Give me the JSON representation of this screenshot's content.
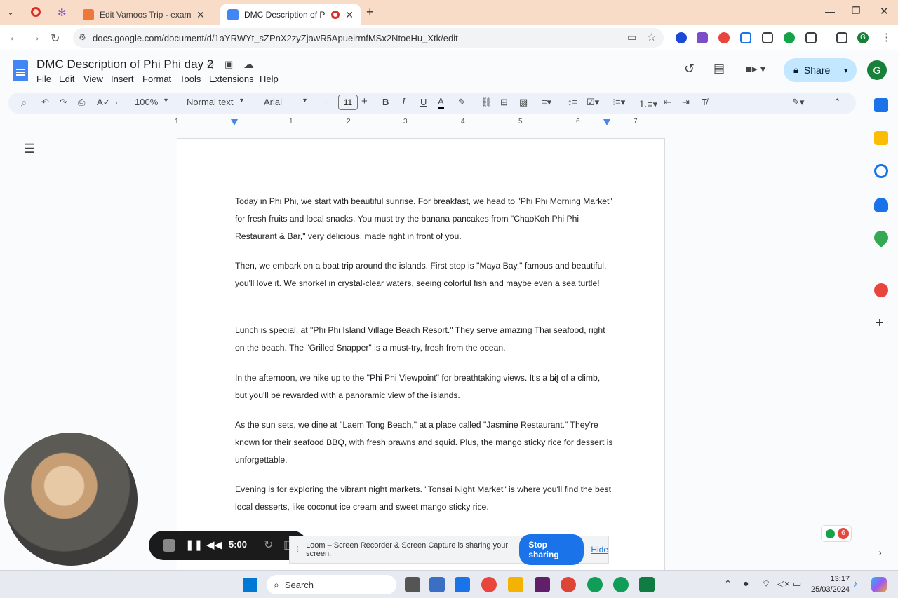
{
  "browser": {
    "tabs": [
      {
        "title": "Edit Vamoos Trip - example-tes",
        "favicon_color": "#f0773a"
      },
      {
        "title": "DMC Description of Phi Phi",
        "favicon_color": "#4285f4"
      }
    ],
    "url": "docs.google.com/document/d/1aYRWYt_sZPnX2zyZjawR5ApueirmfMSx2NtoeHu_Xtk/edit"
  },
  "docs": {
    "title": "DMC Description of Phi Phi day 2",
    "menu": [
      "File",
      "Edit",
      "View",
      "Insert",
      "Format",
      "Tools",
      "Extensions",
      "Help"
    ],
    "share_label": "Share",
    "avatar_letter": "G",
    "toolbar": {
      "zoom": "100%",
      "style": "Normal text",
      "font": "Arial",
      "font_size": "11"
    },
    "ruler_ticks": [
      "1",
      "1",
      "2",
      "3",
      "4",
      "5",
      "6",
      "7"
    ],
    "paragraphs": [
      "Today in Phi Phi, we start with beautiful sunrise. For breakfast, we head to \"Phi Phi Morning Market\" for fresh fruits and local snacks. You must try the banana pancakes from \"ChaoKoh Phi Phi Restaurant & Bar,\" very delicious, made right in front of you.",
      "Then, we embark on a boat trip around the islands. First stop is \"Maya Bay,\" famous and beautiful, you'll love it. We snorkel in crystal-clear waters, seeing colorful fish and maybe even a sea turtle!",
      "Lunch is special, at \"Phi Phi Island Village Beach Resort.\" They serve amazing Thai seafood, right on the beach. The \"Grilled Snapper\" is a must-try, fresh from the ocean.",
      "In the afternoon, we hike up to the \"Phi Phi Viewpoint\" for breathtaking views. It's a bit of a climb, but you'll be rewarded with a panoramic view of the islands.",
      "As the sun sets, we dine at \"Laem Tong Beach,\" at a place called \"Jasmine Restaurant.\" They're known for their seafood BBQ, with fresh prawns and squid. Plus, the mango sticky rice for dessert is unforgettable.",
      "Evening is for exploring the vibrant night markets. \"Tonsai Night Market\" is where you'll find the best local desserts, like coconut ice cream and sweet mango sticky rice."
    ]
  },
  "loom": {
    "timer": "5:00",
    "sharing_text": "Loom – Screen Recorder & Screen Capture is sharing your screen.",
    "stop_label": "Stop sharing",
    "hide_label": "Hide"
  },
  "badge_count": "6",
  "taskbar": {
    "search_placeholder": "Search",
    "time": "13:17",
    "date": "25/03/2024"
  }
}
